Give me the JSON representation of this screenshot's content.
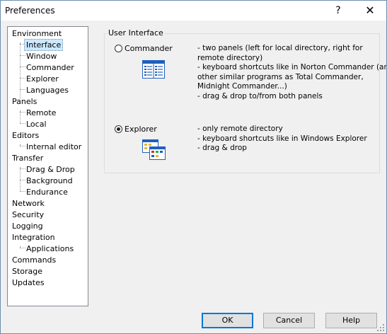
{
  "window": {
    "title": "Preferences",
    "help_glyph": "?",
    "close_glyph": "✕"
  },
  "tree": {
    "items": [
      {
        "label": "Environment"
      },
      {
        "label": "Interface",
        "selected": true
      },
      {
        "label": "Window"
      },
      {
        "label": "Commander"
      },
      {
        "label": "Explorer"
      },
      {
        "label": "Languages"
      },
      {
        "label": "Panels"
      },
      {
        "label": "Remote"
      },
      {
        "label": "Local"
      },
      {
        "label": "Editors"
      },
      {
        "label": "Internal editor"
      },
      {
        "label": "Transfer"
      },
      {
        "label": "Drag & Drop"
      },
      {
        "label": "Background"
      },
      {
        "label": "Endurance"
      },
      {
        "label": "Network"
      },
      {
        "label": "Security"
      },
      {
        "label": "Logging"
      },
      {
        "label": "Integration"
      },
      {
        "label": "Applications"
      },
      {
        "label": "Commands"
      },
      {
        "label": "Storage"
      },
      {
        "label": "Updates"
      }
    ]
  },
  "interface": {
    "group_title": "User Interface",
    "commander": {
      "label": "Commander",
      "checked": false,
      "icon": "commander-interface-icon",
      "desc": [
        "- two panels (left for local directory, right for",
        "remote directory)",
        "- keyboard shortcuts like in Norton Commander (and",
        "other similar programs as Total Commander,",
        "Midnight Commander...)",
        "- drag & drop to/from both panels"
      ]
    },
    "explorer": {
      "label": "Explorer",
      "checked": true,
      "icon": "explorer-interface-icon",
      "desc": [
        "- only remote directory",
        "- keyboard shortcuts like in Windows Explorer",
        "- drag & drop"
      ]
    }
  },
  "buttons": {
    "ok": "OK",
    "cancel": "Cancel",
    "help": "Help"
  },
  "colors": {
    "selection": "#cce8ff",
    "default_button_border": "#0078d7",
    "icon_blue": "#1f5fbf"
  }
}
